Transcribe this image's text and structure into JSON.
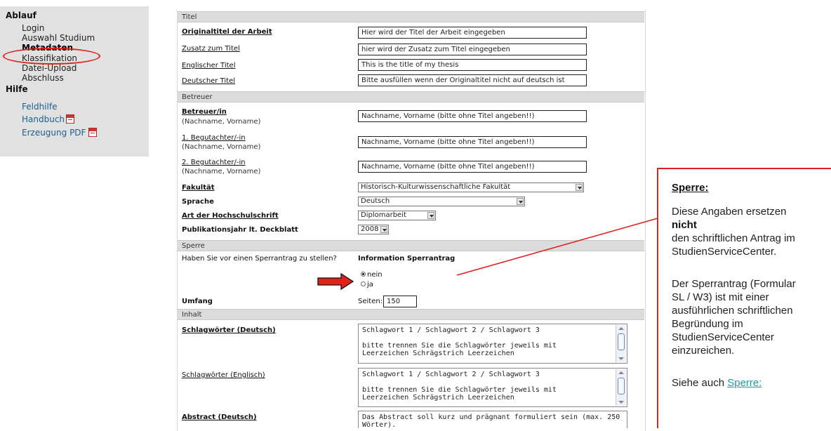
{
  "sidebar": {
    "ablauf_heading": "Ablauf",
    "ablauf_items": [
      "Login",
      "Auswahl Studium",
      "Metadaten",
      "Klassifikation",
      "Datei-Upload",
      "Abschluss"
    ],
    "hilfe_heading": "Hilfe",
    "hilfe_items": [
      "Feldhilfe",
      "Handbuch",
      "Erzeugung PDF"
    ]
  },
  "titel": {
    "section": "Titel",
    "original_label": "Originaltitel der Arbeit",
    "original_value": "Hier wird der Titel der Arbeit eingegeben",
    "zusatz_label": "Zusatz zum Titel",
    "zusatz_value": "hier wird der Zusatz zum Titel eingegeben",
    "englisch_label": "Englischer Titel",
    "englisch_value": "This is the title of my thesis",
    "deutsch_label": "Deutscher Titel",
    "deutsch_value": "Bitte ausfüllen wenn der Originaltitel nicht auf deutsch ist"
  },
  "betreuer": {
    "section": "Betreuer",
    "betreuer_label": "Betreuer/in",
    "betreuer_sub": "(Nachname, Vorname)",
    "betreuer_value": "Nachname, Vorname  (bitte ohne Titel angeben!!)",
    "gutachter1_label": "1. Begutachter/-in",
    "gutachter1_sub": "(Nachname, Vorname)",
    "gutachter1_value": "Nachname, Vorname  (bitte ohne Titel angeben!!)",
    "gutachter2_label": "2. Begutachter/-in",
    "gutachter2_sub": "(Nachname, Vorname)",
    "gutachter2_value": "Nachname, Vorname  (bitte ohne Titel angeben!!)",
    "fakultaet_label": "Fakultät",
    "fakultaet_value": "Historisch-Kulturwissenschaftliche Fakultät",
    "sprache_label": "Sprache",
    "sprache_value": "Deutsch",
    "art_label": "Art der Hochschulschrift",
    "art_value": "Diplomarbeit",
    "jahr_label": "Publikationsjahr lt. Deckblatt",
    "jahr_value": "2008"
  },
  "sperre": {
    "section": "Sperre",
    "question": "Haben Sie vor einen Sperrantrag zu stellen?",
    "info_label": "Information Sperrantrag",
    "option_nein": "nein",
    "option_ja": "ja",
    "umfang_label": "Umfang",
    "seiten_label": "Seiten:",
    "seiten_value": "150"
  },
  "inhalt": {
    "section": "Inhalt",
    "sw_de_label": "Schlagwörter (Deutsch)",
    "sw_de_line1": "Schlagwort 1 / Schlagwort 2 / Schlagwort 3",
    "sw_de_line2": "bitte trennen Sie die Schlagwörter jeweils mit",
    "sw_de_line3": "Leerzeichen Schrägstrich Leerzeichen",
    "sw_en_label": "Schlagwörter (Englisch)",
    "sw_en_line1": "Schlagwort 1 / Schlagwort 2 / Schlagwort 3",
    "sw_en_line2": "bitte trennen Sie die Schlagwörter jeweils mit",
    "sw_en_line3": "Leerzeichen Schrägstrich Leerzeichen",
    "abstract_label": "Abstract (Deutsch)",
    "abstract_line1": "Das Abstract soll kurz und prägnant formuliert sein (max. 250",
    "abstract_line2": "Wörter)."
  },
  "callout": {
    "title": "Sperre:",
    "p1_line1": "Diese Angaben ersetzen",
    "p1_bold": "nicht",
    "p1_line3": "den schriftlichen Antrag im",
    "p1_line4": "StudienServiceCenter.",
    "p2_line1": "Der Sperrantrag (Formular",
    "p2_line2": "SL / W3) ist mit einer",
    "p2_line3": "ausführlichen schriftlichen",
    "p2_line4": "Begründung im",
    "p2_line5": "StudienServiceCenter",
    "p2_line6": "einzureichen.",
    "see_also": "Siehe auch",
    "link": "Sperre:"
  },
  "colors": {
    "annotation_red": "#e0221b",
    "link_teal": "#1f9aa5",
    "sidebar_link": "#1b5f8f"
  }
}
